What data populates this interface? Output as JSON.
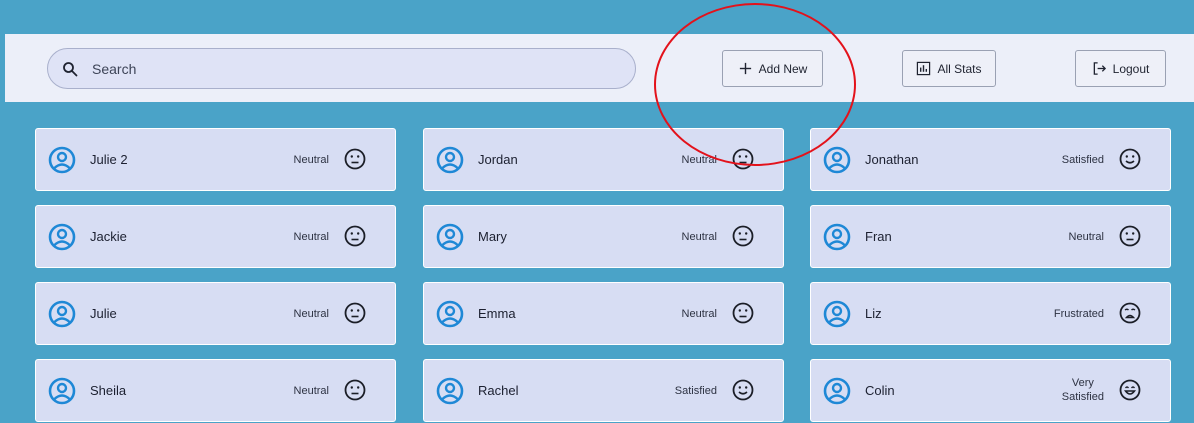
{
  "header": {
    "search_placeholder": "Search",
    "add_new_label": "Add New",
    "all_stats_label": "All Stats",
    "logout_label": "Logout"
  },
  "colors": {
    "background": "#4aa3c8",
    "card": "#d7ddf3",
    "avatar_accent": "#1e88d6",
    "annotation": "#e3121b"
  },
  "contacts": [
    {
      "name": "Julie 2",
      "status": "Neutral",
      "face_icon": "neutral-face-icon"
    },
    {
      "name": "Jordan",
      "status": "Neutral",
      "face_icon": "neutral-face-icon"
    },
    {
      "name": "Jonathan",
      "status": "Satisfied",
      "face_icon": "smile-face-icon"
    },
    {
      "name": "Jackie",
      "status": "Neutral",
      "face_icon": "neutral-face-icon"
    },
    {
      "name": "Mary",
      "status": "Neutral",
      "face_icon": "neutral-face-icon"
    },
    {
      "name": "Fran",
      "status": "Neutral",
      "face_icon": "neutral-face-icon"
    },
    {
      "name": "Julie",
      "status": "Neutral",
      "face_icon": "neutral-face-icon"
    },
    {
      "name": "Emma",
      "status": "Neutral",
      "face_icon": "neutral-face-icon"
    },
    {
      "name": "Liz",
      "status": "Frustrated",
      "face_icon": "frustrated-face-icon"
    },
    {
      "name": "Sheila",
      "status": "Neutral",
      "face_icon": "neutral-face-icon"
    },
    {
      "name": "Rachel",
      "status": "Satisfied",
      "face_icon": "smile-face-icon"
    },
    {
      "name": "Colin",
      "status": "Very\nSatisfied",
      "face_icon": "grin-face-icon"
    }
  ]
}
